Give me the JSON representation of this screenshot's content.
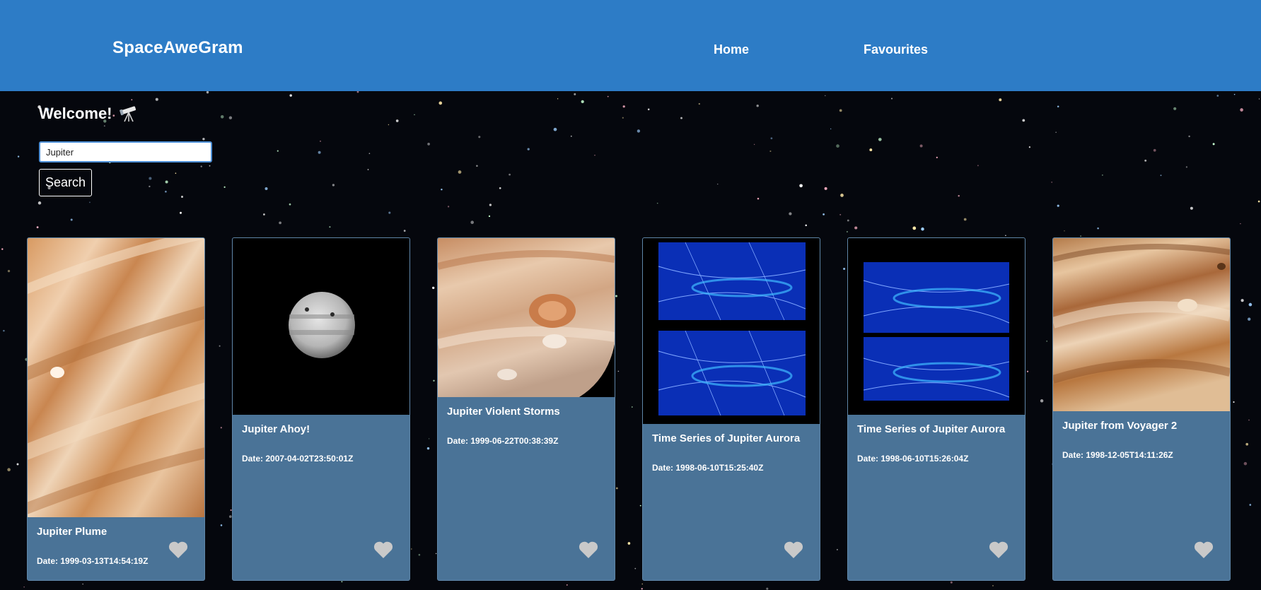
{
  "navbar": {
    "brand": "SpaceAweGram",
    "links": [
      {
        "label": "Home"
      },
      {
        "label": "Favourites"
      }
    ]
  },
  "welcome": {
    "text": "Welcome!",
    "icon": "telescope-icon"
  },
  "search": {
    "value": "Jupiter",
    "button_label": "Search"
  },
  "cards": [
    {
      "title": "Jupiter Plume",
      "date": "Date: 1999-03-13T14:54:19Z",
      "image": "jupiter-clouds-closeup",
      "liked": false
    },
    {
      "title": "Jupiter Ahoy!",
      "date": "Date: 2007-04-02T23:50:01Z",
      "image": "jupiter-grayscale-disk",
      "liked": false
    },
    {
      "title": "Jupiter Violent Storms",
      "date": "Date: 1999-06-22T00:38:39Z",
      "image": "jupiter-great-red-spot",
      "liked": false
    },
    {
      "title": "Time Series of Jupiter Aurora",
      "date": "Date: 1998-06-10T15:25:40Z",
      "image": "jupiter-aurora-series",
      "liked": false
    },
    {
      "title": "Time Series of Jupiter Aurora",
      "date": "Date: 1998-06-10T15:26:04Z",
      "image": "jupiter-aurora-series",
      "liked": false
    },
    {
      "title": "Jupiter from Voyager 2",
      "date": "Date: 1998-12-05T14:11:26Z",
      "image": "jupiter-voyager-bands",
      "liked": false
    }
  ],
  "colors": {
    "navbar": "#2d7cc6",
    "card": "#4a7397",
    "heart": "#c9c9c9",
    "background": "#05070d"
  }
}
